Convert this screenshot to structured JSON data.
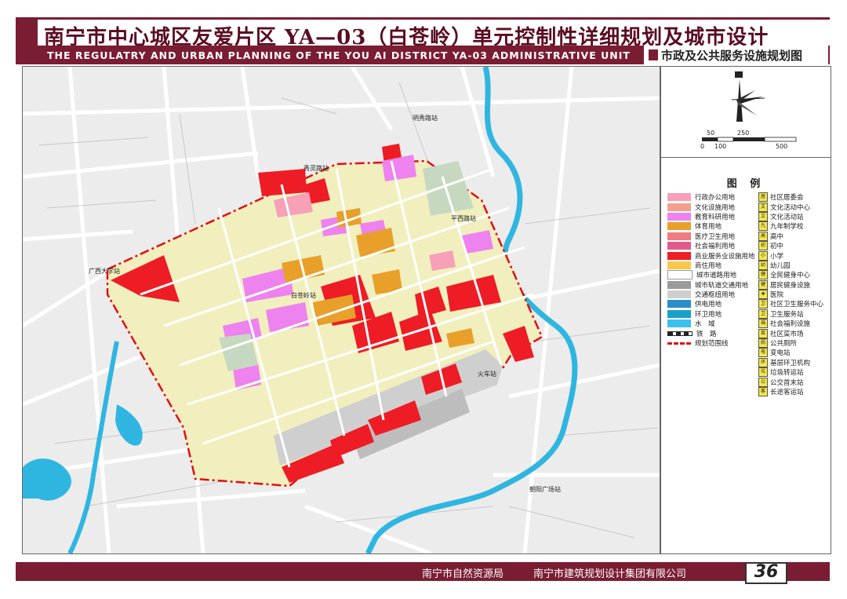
{
  "header": {
    "title": "南宁市中心城区友爱片区 YA—03（白苍岭）单元控制性详细规划及城市设计",
    "subtitle_en": "THE REGULATRY AND URBAN PLANNING OF THE YOU AI DISTRICT YA-03 ADMINISTRATIVE UNIT",
    "map_name": "市政及公共服务设施规划图"
  },
  "map": {
    "place_labels": {
      "mingxiu": "明秀路站",
      "xiuling": "秀灵路站",
      "guangxi_univ": "广西大学站",
      "baicangling": "白苍岭站",
      "railway": "火车站",
      "chaoyang": "朝阳广场站",
      "pingxi": "平西路站"
    },
    "scale": {
      "top_ticks": [
        "50",
        "250"
      ],
      "bottom_ticks": [
        "0",
        "100",
        "500"
      ]
    }
  },
  "legend": {
    "title": "图 例",
    "landuse": [
      {
        "label": "行政办公用地",
        "color": "#f7a0b8"
      },
      {
        "label": "文化设施用地",
        "color": "#f4a08c"
      },
      {
        "label": "教育科研用地",
        "color": "#ee82ee"
      },
      {
        "label": "体育用地",
        "color": "#e8a02a"
      },
      {
        "label": "医疗卫生用地",
        "color": "#f07a86"
      },
      {
        "label": "社会福利用地",
        "color": "#e25a8a"
      },
      {
        "label": "商业服务业设施用地",
        "color": "#ee1c25"
      },
      {
        "label": "商住用地",
        "color": "#f7c84a"
      },
      {
        "label": "城市道路用地",
        "color": "#ffffff"
      },
      {
        "label": "城市轨道交通用地",
        "color": "#9a9a9a"
      },
      {
        "label": "交通枢纽用地",
        "color": "#cfcfcf"
      },
      {
        "label": "供电用地",
        "color": "#2a8fc8"
      },
      {
        "label": "环卫用地",
        "color": "#1a9fc8"
      },
      {
        "label": "水　域",
        "color": "#3cc0ee"
      },
      {
        "label": "铁　路",
        "color": "#222222"
      },
      {
        "label": "规划范围线",
        "color": "#e01010"
      }
    ],
    "facilities": [
      {
        "label": "社区居委会",
        "icon": "居"
      },
      {
        "label": "文化活动中心",
        "icon": "文"
      },
      {
        "label": "文化活动站",
        "icon": "文"
      },
      {
        "label": "九年制学校",
        "icon": "九"
      },
      {
        "label": "高中",
        "icon": "高"
      },
      {
        "label": "初中",
        "icon": "初"
      },
      {
        "label": "小学",
        "icon": "小"
      },
      {
        "label": "幼儿园",
        "icon": "幼"
      },
      {
        "label": "全民健身中心",
        "icon": "健"
      },
      {
        "label": "居民健身设施",
        "icon": "健"
      },
      {
        "label": "医院",
        "icon": "✚"
      },
      {
        "label": "社区卫生服务中心",
        "icon": "卫"
      },
      {
        "label": "卫生服务站",
        "icon": "卫"
      },
      {
        "label": "社会福利设施",
        "icon": "福"
      },
      {
        "label": "社区菜市场",
        "icon": "菜"
      },
      {
        "label": "公共厕所",
        "icon": "厕"
      },
      {
        "label": "变电站",
        "icon": "电"
      },
      {
        "label": "基层环卫机构",
        "icon": "环"
      },
      {
        "label": "垃圾转运站",
        "icon": "垃"
      },
      {
        "label": "公交首末站",
        "icon": "公"
      },
      {
        "label": "长途客运站",
        "icon": "客"
      }
    ]
  },
  "footer": {
    "org1": "南宁市自然资源局",
    "org2": "南宁市建筑规划设计集团有限公司",
    "page": "36"
  }
}
